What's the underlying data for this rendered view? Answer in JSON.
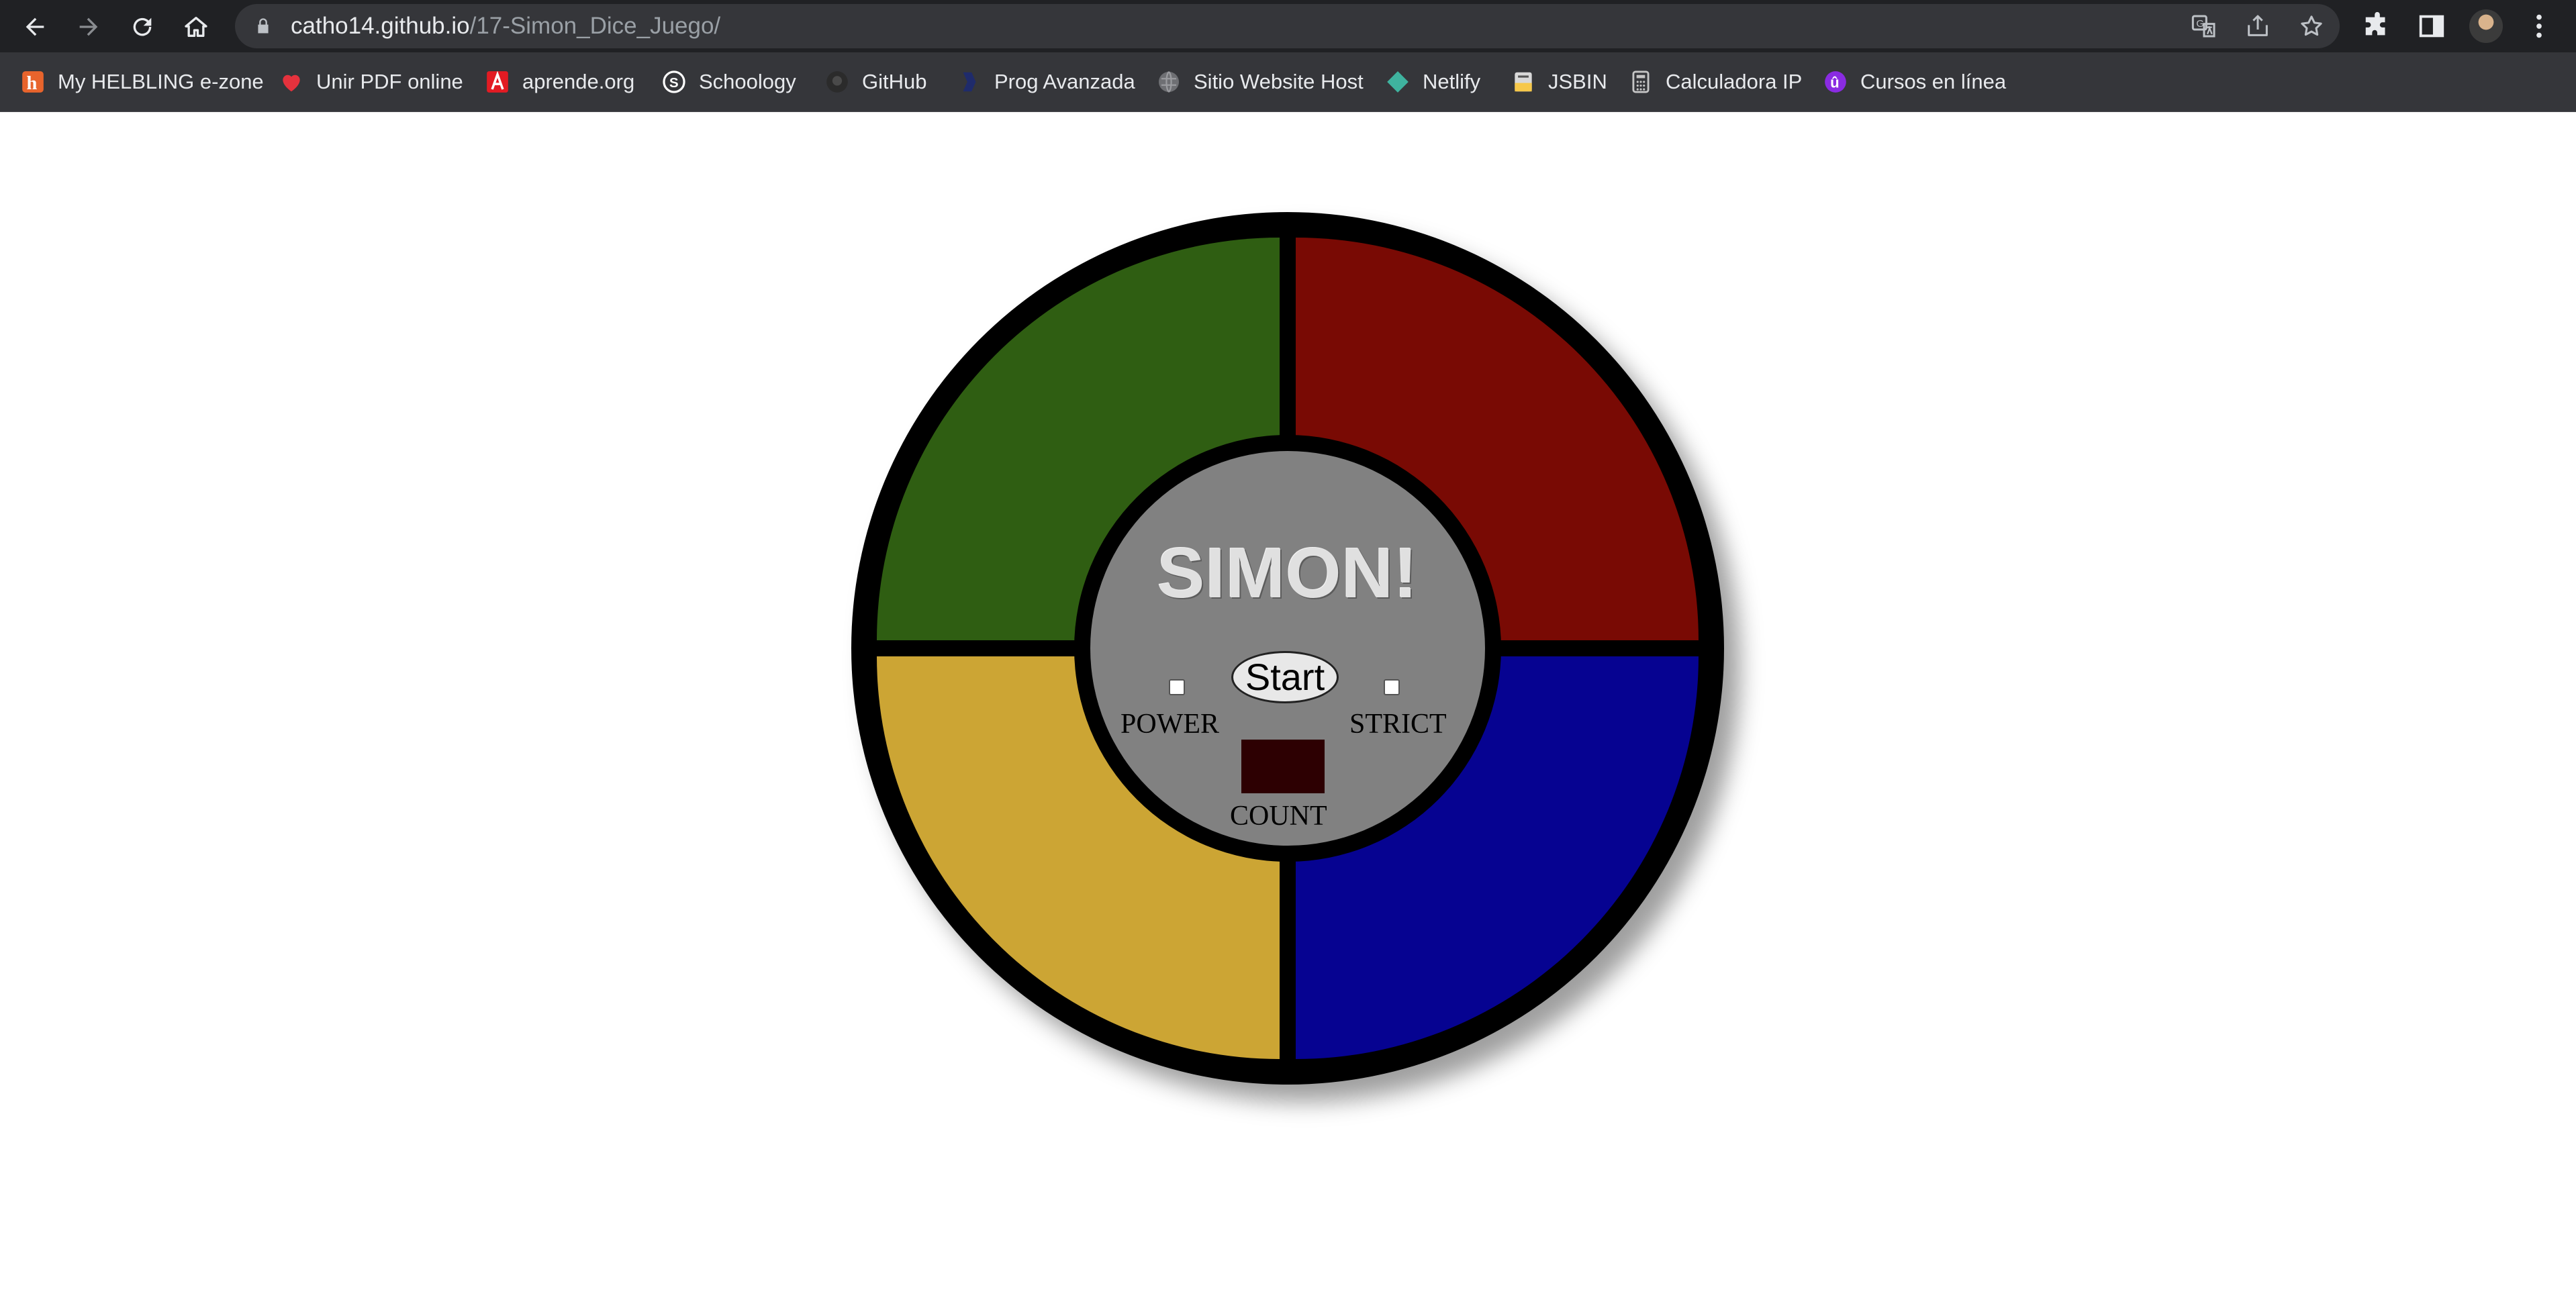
{
  "browser": {
    "url_host": "catho14.github.io",
    "url_path": "/17-Simon_Dice_Juego/",
    "bookmarks": [
      {
        "label": "My HELBLING e-zone",
        "icon": "helbling-icon",
        "color": "#e8642c"
      },
      {
        "label": "Unir PDF online",
        "icon": "heart-icon",
        "color": "#e5323d"
      },
      {
        "label": "aprende.org",
        "icon": "aprende-icon",
        "color": "#e31b23"
      },
      {
        "label": "Schoology",
        "icon": "schoology-icon",
        "color": "#ffffff"
      },
      {
        "label": "GitHub",
        "icon": "github-icon",
        "color": "#2b2b2b"
      },
      {
        "label": "Prog Avanzada",
        "icon": "prog-icon",
        "color": "#1f2b6b"
      },
      {
        "label": "Sitio Website Host",
        "icon": "globe-icon",
        "color": "#6e6f73"
      },
      {
        "label": "Netlify",
        "icon": "netlify-icon",
        "color": "#3fb39f"
      },
      {
        "label": "JSBIN",
        "icon": "jsbin-icon",
        "color": "#f6c84a"
      },
      {
        "label": "Calculadora IP",
        "icon": "calculator-icon",
        "color": "#c6c6c6"
      },
      {
        "label": "Cursos en línea",
        "icon": "cursos-icon",
        "color": "#8a2be2"
      }
    ]
  },
  "game": {
    "title": "SIMON!",
    "start_label": "Start",
    "power_label": "POWER",
    "strict_label": "STRICT",
    "count_label": "COUNT",
    "power_on": false,
    "strict_on": false,
    "colors": {
      "green": "#2f5e12",
      "red": "#790a04",
      "yellow": "#cca534",
      "blue": "#060391",
      "count_display": "#2d0002"
    }
  }
}
